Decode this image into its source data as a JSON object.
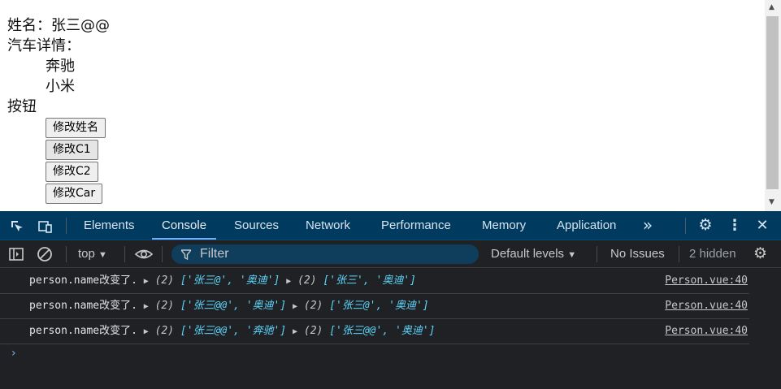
{
  "page": {
    "name_line": "姓名：张三@@",
    "car_label": "汽车详情：",
    "cars": [
      "奔驰",
      "小米"
    ],
    "buttons_label": "按钮",
    "buttons": [
      "修改姓名",
      "修改C1",
      "修改C2",
      "修改Car"
    ]
  },
  "devtools": {
    "tabs": [
      "Elements",
      "Console",
      "Sources",
      "Network",
      "Performance",
      "Memory",
      "Application"
    ],
    "active_tab": "Console",
    "more_tabs": "»",
    "toolbar": {
      "context": "top",
      "filter_placeholder": "Filter",
      "levels": "Default levels",
      "issues": "No Issues",
      "hidden": "2 hidden"
    },
    "logs": [
      {
        "prefix": "person.name改变了.",
        "new_count": "(2)",
        "new_val": "['张三@', '奥迪']",
        "old_count": "(2)",
        "old_val": "['张三', '奥迪']",
        "source": "Person.vue:40"
      },
      {
        "prefix": "person.name改变了.",
        "new_count": "(2)",
        "new_val": "['张三@@', '奥迪']",
        "old_count": "(2)",
        "old_val": "['张三@', '奥迪']",
        "source": "Person.vue:40"
      },
      {
        "prefix": "person.name改变了.",
        "new_count": "(2)",
        "new_val": "['张三@@', '奔驰']",
        "old_count": "(2)",
        "old_val": "['张三@@', '奥迪']",
        "source": "Person.vue:40"
      }
    ],
    "prompt": "›"
  },
  "colors": {
    "devtools_bg": "#202124",
    "tabbar_bg": "#003a5f",
    "string": "#5cd5fb",
    "active_underline": "#7cacf8"
  }
}
